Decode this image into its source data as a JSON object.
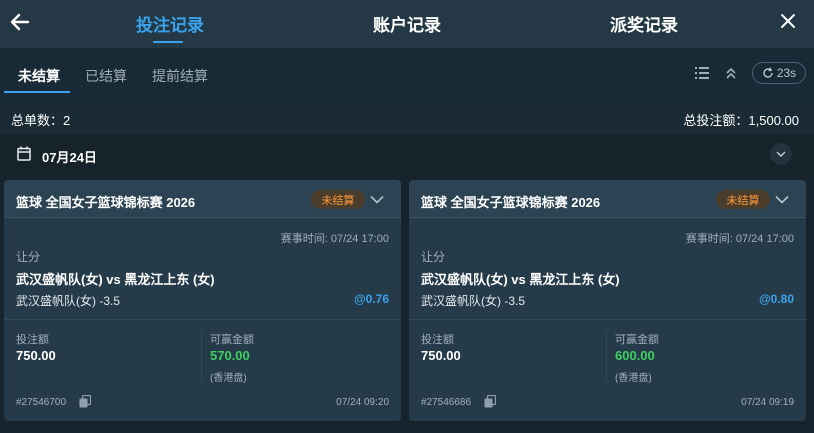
{
  "header": {
    "tabs": [
      {
        "label": "投注记录",
        "active": true
      },
      {
        "label": "账户记录",
        "active": false
      },
      {
        "label": "派奖记录",
        "active": false
      }
    ]
  },
  "sub_tabs": [
    {
      "label": "未结算",
      "active": true
    },
    {
      "label": "已结算",
      "active": false
    },
    {
      "label": "提前结算",
      "active": false
    }
  ],
  "refresh": {
    "label": "23s"
  },
  "summary": {
    "count_label": "总单数：2",
    "total_label": "总投注额：1,500.00"
  },
  "date_group": {
    "label": "07月24日"
  },
  "labels": {
    "stake": "投注额",
    "potential_win": "可赢金额",
    "time_prefix": "赛事时间:"
  },
  "bets": [
    {
      "title": "篮球 全国女子篮球锦标赛 2026",
      "status": "未结算",
      "event_time": "赛事时间: 07/24 17:00",
      "bet_type": "让分",
      "match": "武汉盛帆队(女) vs 黑龙江上东 (女)",
      "selection": "武汉盛帆队(女) -3.5",
      "odds": "@0.76",
      "stake": "750.00",
      "potential_win": "570.00",
      "odds_type": "(香港盘)",
      "ticket": "#27546700",
      "placed_time": "07/24 09:20"
    },
    {
      "title": "篮球 全国女子篮球锦标赛 2026",
      "status": "未结算",
      "event_time": "赛事时间: 07/24 17:00",
      "bet_type": "让分",
      "match": "武汉盛帆队(女) vs 黑龙江上东 (女)",
      "selection": "武汉盛帆队(女) -3.5",
      "odds": "@0.80",
      "stake": "750.00",
      "potential_win": "600.00",
      "odds_type": "(香港盘)",
      "ticket": "#27546686",
      "placed_time": "07/24 09:19"
    }
  ],
  "colors": {
    "accent": "#3aa3ec",
    "status_pending": "#ff9b3a",
    "win_green": "#3fcf63"
  }
}
